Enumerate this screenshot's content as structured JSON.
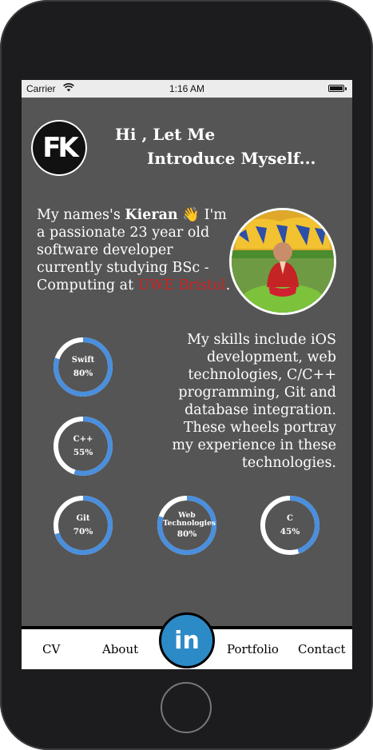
{
  "status": {
    "carrier": "Carrier",
    "time": "1:16 AM"
  },
  "header": {
    "logo_text": "FK",
    "greeting_line1": "Hi , Let Me",
    "greeting_line2": "Introduce Myself..."
  },
  "intro": {
    "prefix": "My names's ",
    "name": "Kieran",
    "emoji": "👋",
    "body": " I'm a passionate 23 year old software developer currently studying BSc - Computing at ",
    "university": "UWE Bristol",
    "suffix": "."
  },
  "skills_text": "My skills include iOS development, web technologies, C/C++ programming, Git and database integration. These wheels portray my experience in these technologies.",
  "wheels": [
    {
      "name": "Swift",
      "percent_label": "80%",
      "value": 0.8
    },
    {
      "name": "C++",
      "percent_label": "55%",
      "value": 0.55
    },
    {
      "name": "Git",
      "percent_label": "70%",
      "value": 0.7
    },
    {
      "name": "Web Technologies",
      "percent_label": "80%",
      "value": 0.8
    },
    {
      "name": "C",
      "percent_label": "45%",
      "value": 0.45
    }
  ],
  "colors": {
    "wheel_progress": "#4a8fdd",
    "wheel_track": "#ffffff",
    "background": "#555555",
    "university": "#d02020",
    "linkedin": "#2c8ac7"
  },
  "tabs": {
    "cv": "CV",
    "about": "About",
    "linkedin": "in",
    "portfolio": "Portfolio",
    "contact": "Contact"
  }
}
